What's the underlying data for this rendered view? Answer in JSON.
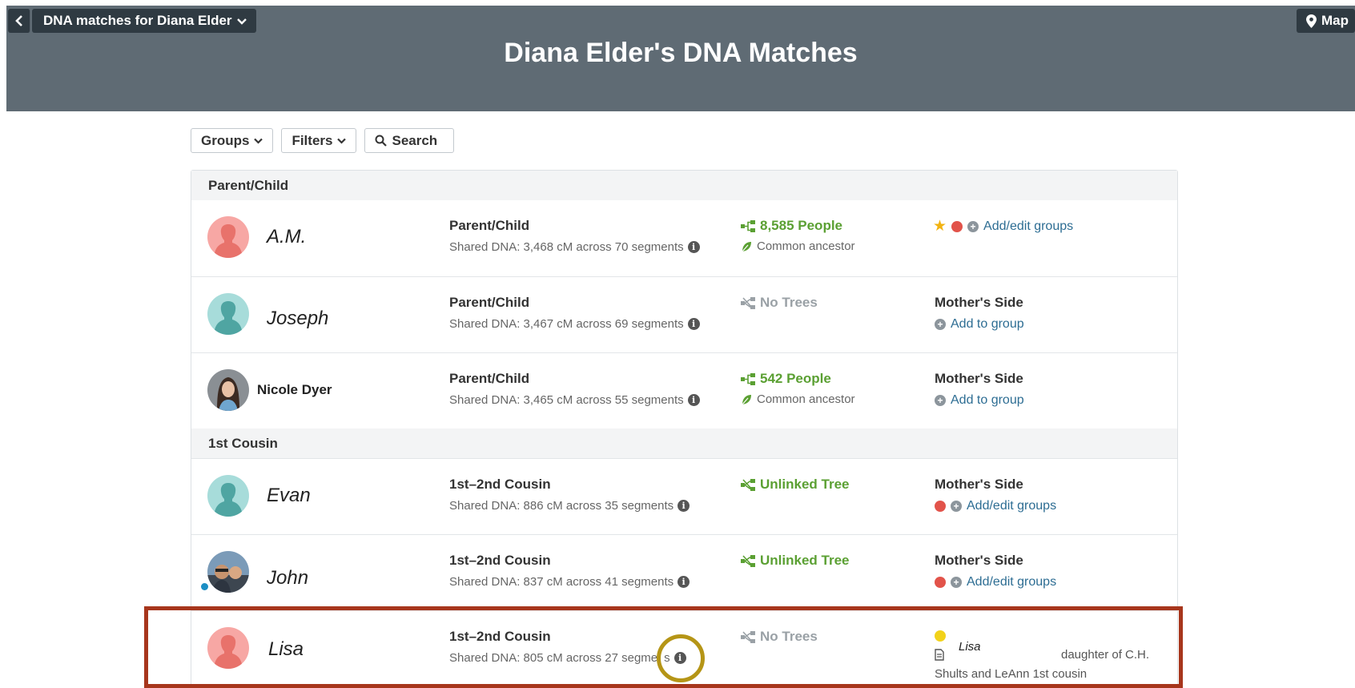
{
  "header": {
    "back_icon": "chevron-left-icon",
    "dropdown_label": "DNA matches for Diana Elder",
    "map_label": "Map",
    "title": "Diana Elder's DNA Matches"
  },
  "controls": {
    "groups_label": "Groups",
    "filters_label": "Filters",
    "search_label": "Search"
  },
  "groups": [
    {
      "label": "Parent/Child",
      "matches": [
        {
          "name": "A.M.",
          "relationship": "Parent/Child",
          "shared": "Shared DNA: 3,468 cM across 70 segments",
          "tree": "8,585 People",
          "tree_status": "linked",
          "common": "Common ancestor",
          "side": "",
          "group_link": "Add/edit groups",
          "avatar": "silhouette-pink",
          "starred": true,
          "dot_color": "#e2534a"
        },
        {
          "name": "Joseph",
          "relationship": "Parent/Child",
          "shared": "Shared DNA: 3,467 cM across 69 segments",
          "tree": "No Trees",
          "tree_status": "none",
          "common": "",
          "side": "Mother's Side",
          "group_link": "Add to group",
          "avatar": "silhouette-teal"
        },
        {
          "name": "Nicole Dyer",
          "relationship": "Parent/Child",
          "shared": "Shared DNA: 3,465 cM across 55 segments",
          "tree": "542 People",
          "tree_status": "linked",
          "common": "Common ancestor",
          "side": "Mother's Side",
          "group_link": "Add to group",
          "avatar": "photo"
        }
      ]
    },
    {
      "label": "1st Cousin",
      "matches": [
        {
          "name": "Evan",
          "relationship": "1st–2nd Cousin",
          "shared": "Shared DNA: 886 cM across 35 segments",
          "tree": "Unlinked Tree",
          "tree_status": "unlinked",
          "side": "Mother's Side",
          "group_link": "Add/edit groups",
          "avatar": "silhouette-teal",
          "dot_color": "#e2534a"
        },
        {
          "name": "John",
          "relationship": "1st–2nd Cousin",
          "shared": "Shared DNA: 837 cM across 41 segments",
          "tree": "Unlinked Tree",
          "tree_status": "unlinked",
          "side": "Mother's Side",
          "group_link": "Add/edit groups",
          "avatar": "photo",
          "dot_color": "#e2534a"
        },
        {
          "name": "Lisa",
          "relationship": "1st–2nd Cousin",
          "shared_prefix": "Shared DNA: 805 cM across 27 segme",
          "shared_suffix": "s",
          "tree": "No Trees",
          "tree_status": "none",
          "note_name": "Lisa",
          "note_line1": "daughter of C.H.",
          "note_line2": "Shults and LeAnn 1st cousin",
          "avatar": "silhouette-pink",
          "dot_color": "#f2d21a"
        }
      ]
    }
  ],
  "colors": {
    "header_bg": "#5f6b74",
    "tree_green": "#5ba033",
    "link_blue": "#2d6d93",
    "highlight_box": "#a7361c",
    "highlight_circle": "#b59516"
  }
}
